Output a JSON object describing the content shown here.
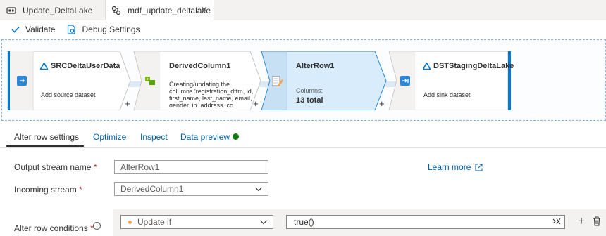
{
  "tabs": [
    {
      "label": "Update_DeltaLake",
      "icon": "pipeline-icon"
    },
    {
      "label": "mdf_update_deltalake",
      "icon": "dataflow-icon",
      "close": "✕"
    }
  ],
  "toolbar": {
    "validate": "Validate",
    "debug": "Debug Settings"
  },
  "nodes": [
    {
      "title": "SRCDeltaUserData",
      "subtitle": "Add source dataset",
      "icon": "delta-icon"
    },
    {
      "title": "DerivedColumn1",
      "description": "Creating/updating the columns 'registration_dttm, id, first_name, last_name, email, gender, ip_address, cc, country,",
      "icon": "derived-column-icon"
    },
    {
      "title": "AlterRow1",
      "columns_label": "Columns:",
      "columns_total": "13 total",
      "icon": "alter-row-icon"
    },
    {
      "title": "DSTStagingDeltaLake",
      "subtitle": "Add sink dataset",
      "icon": "delta-icon"
    }
  ],
  "plus": "+",
  "panel_tabs": [
    {
      "label": "Alter row settings"
    },
    {
      "label": "Optimize"
    },
    {
      "label": "Inspect"
    },
    {
      "label": "Data preview"
    }
  ],
  "form": {
    "output_stream": {
      "label": "Output stream name",
      "value": "AlterRow1"
    },
    "incoming_stream": {
      "label": "Incoming stream",
      "value": "DerivedColumn1"
    },
    "learn_more": "Learn more",
    "conditions": {
      "label": "Alter row conditions",
      "info": "i",
      "condition_type": "Update if",
      "expression": "true()"
    },
    "required": "*"
  },
  "colors": {
    "accent": "#0078d4",
    "selected_node": "#d8ecfb",
    "status_dot": "#107c10"
  }
}
